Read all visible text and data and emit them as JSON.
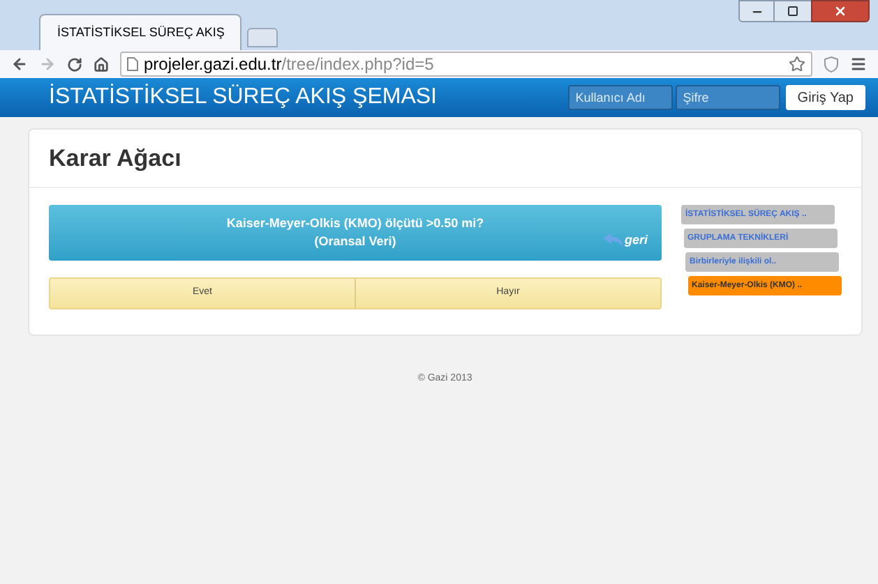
{
  "browser": {
    "tab_title": "İSTATİSTİKSEL SÜREÇ AKIŞ",
    "url_host": "projeler.gazi.edu.tr",
    "url_path": "/tree/index.php?id=5"
  },
  "navbar": {
    "brand": "İSTATİSTİKSEL SÜREÇ AKIŞ ŞEMASI",
    "username": {
      "placeholder": "Kullanıcı Adı"
    },
    "password": {
      "placeholder": "Şifre"
    },
    "login_button": "Giriş Yap"
  },
  "page": {
    "title": "Karar Ağacı",
    "question": {
      "line1": "Kaiser-Meyer-Olkis (KMO) ölçütü >0.50 mi?",
      "line2": "(Oransal Veri)",
      "back": "geri"
    },
    "answers": [
      "Evet",
      "Hayır"
    ],
    "breadcrumbs": [
      {
        "label": "İSTATİSTİKSEL SÜREÇ AKIŞ ..",
        "selected": false
      },
      {
        "label": "GRUPLAMA TEKNİKLERİ",
        "selected": false
      },
      {
        "label": "Birbirleriyle ilişkili ol..",
        "selected": false
      },
      {
        "label": "Kaiser-Meyer-Olkis (KMO) ..",
        "selected": true
      }
    ]
  },
  "footer": "© Gazi 2013"
}
